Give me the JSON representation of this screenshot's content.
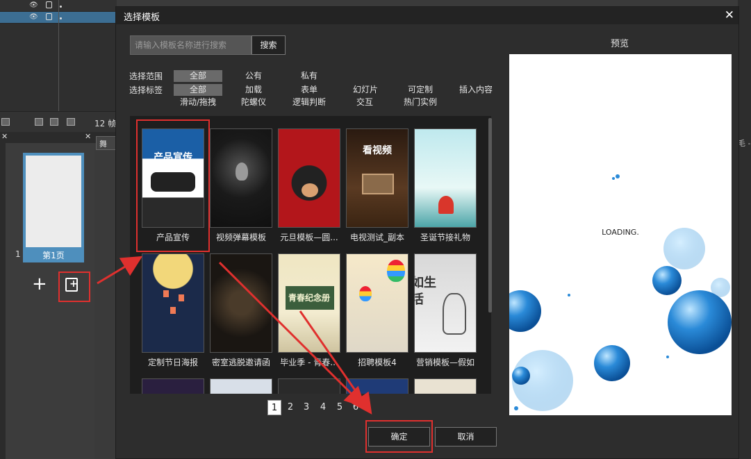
{
  "editor": {
    "frames_label": "12 帧",
    "stage_tab_label": "舞",
    "right_tab_label": "毛 -",
    "page_number": "1",
    "page_label": "第1页",
    "add_icon": "plus-icon",
    "template_icon": "add-template-icon"
  },
  "dialog": {
    "title": "选择模板",
    "close_glyph": "✕",
    "search": {
      "placeholder": "请输入模板名称进行搜索",
      "value": "",
      "button": "搜索"
    },
    "scope": {
      "label": "选择范围",
      "options": [
        "全部",
        "公有",
        "私有"
      ],
      "selected": "全部"
    },
    "tags": {
      "label": "选择标签",
      "row1": [
        "全部",
        "加载",
        "表单",
        "幻灯片",
        "可定制",
        "插入内容"
      ],
      "row2": [
        "滑动/拖拽",
        "陀螺仪",
        "逻辑判断",
        "交互",
        "热门实例"
      ],
      "selected": "全部"
    },
    "templates": [
      {
        "name": "产品宣传",
        "art": "产品宣传",
        "selected": true
      },
      {
        "name": "视频弹幕模板",
        "art": ""
      },
      {
        "name": "元旦模板—圆...",
        "art": ""
      },
      {
        "name": "电视测试_副本",
        "art": "看视频"
      },
      {
        "name": "圣诞节接礼物",
        "art": ""
      },
      {
        "name": "定制节日海报",
        "art": ""
      },
      {
        "name": "密室逃脱邀请函",
        "art": ""
      },
      {
        "name": "毕业季 - 青春...",
        "art": "青春纪念册"
      },
      {
        "name": "招聘模板4",
        "art": ""
      },
      {
        "name": "营销模板—假如",
        "art": "假如生活"
      }
    ],
    "pages": [
      "1",
      "2",
      "3",
      "4",
      "5",
      "6"
    ],
    "current_page": "1",
    "ok_label": "确定",
    "cancel_label": "取消",
    "preview_label": "预览",
    "loading_text": "LOADING."
  },
  "colors": {
    "highlight": "#e0302e",
    "check": "#f07a25",
    "page_accent": "#4e8fbd"
  }
}
